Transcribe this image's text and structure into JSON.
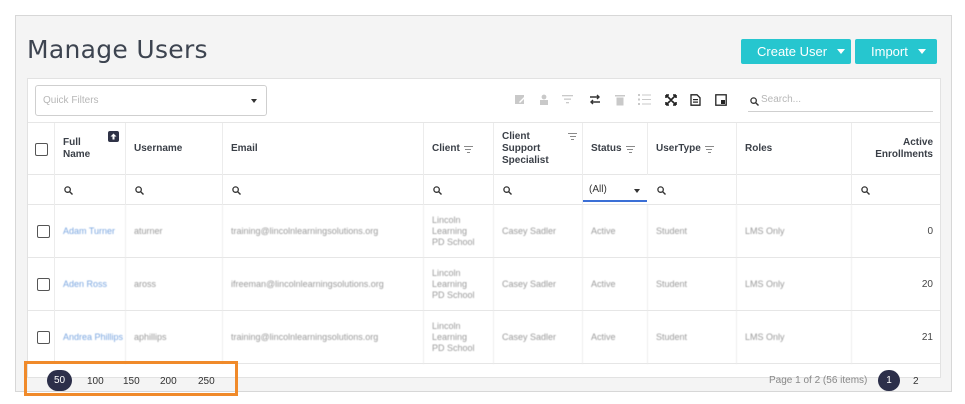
{
  "page": {
    "title": "Manage Users",
    "create_button": "Create User",
    "import_button": "Import"
  },
  "toolbar": {
    "quick_filter_placeholder": "Quick Filters",
    "search_placeholder": "Search...",
    "icons": [
      "edit-icon",
      "user-lock-icon",
      "filter-icon",
      "swap-icon",
      "trash-icon",
      "checklist-icon",
      "expand-icon",
      "export-icon",
      "columns-icon"
    ]
  },
  "columns": {
    "full_name": "Full Name",
    "username": "Username",
    "email": "Email",
    "client": "Client",
    "support": "Client Support Specialist",
    "status": "Status",
    "usertype": "UserType",
    "roles": "Roles",
    "enrollments": "Active Enrollments"
  },
  "filters": {
    "status_value": "(All)"
  },
  "rows": [
    {
      "full_name": "Adam Turner",
      "username": "aturner",
      "email": "training@lincolnlearningsolutions.org",
      "client": "Lincoln Learning PD School",
      "support": "Casey Sadler",
      "status": "Active",
      "usertype": "Student",
      "roles": "LMS Only",
      "enrollments": "0"
    },
    {
      "full_name": "Aden Ross",
      "username": "aross",
      "email": "ifreeman@lincolnlearningsolutions.org",
      "client": "Lincoln Learning PD School",
      "support": "Casey Sadler",
      "status": "Active",
      "usertype": "Student",
      "roles": "LMS Only",
      "enrollments": "20"
    },
    {
      "full_name": "Andrea Phillips",
      "username": "aphillips",
      "email": "training@lincolnlearningsolutions.org",
      "client": "Lincoln Learning PD School",
      "support": "Casey Sadler",
      "status": "Active",
      "usertype": "Student",
      "roles": "LMS Only",
      "enrollments": "21"
    }
  ],
  "pagination": {
    "page_sizes": [
      "50",
      "100",
      "150",
      "200",
      "250"
    ],
    "selected_page_size": "50",
    "info": "Page 1 of 2 (56 items)",
    "pages": [
      "1",
      "2"
    ],
    "current_page": "1"
  },
  "colors": {
    "accent": "#26c6cf",
    "highlight": "#f08a2a",
    "active_page": "#2c2f4a",
    "link": "#7aa6e0"
  }
}
